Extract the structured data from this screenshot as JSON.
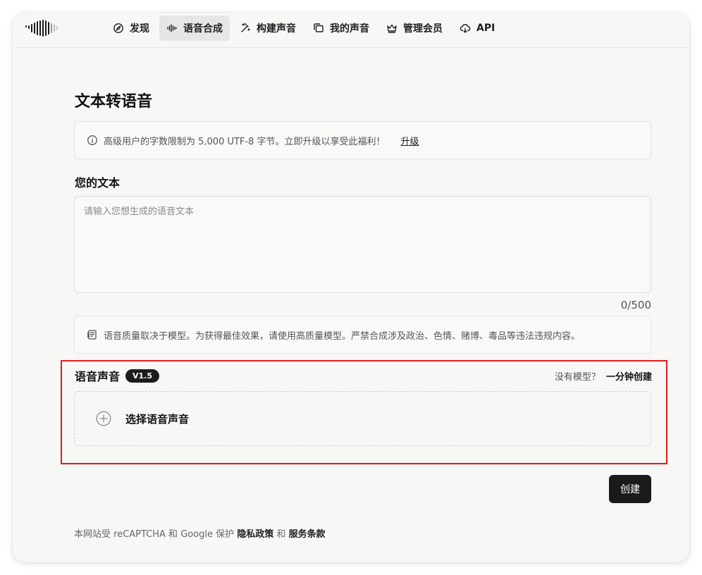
{
  "nav": {
    "items": [
      {
        "label": "发现",
        "icon": "compass-icon",
        "active": false
      },
      {
        "label": "语音合成",
        "icon": "waveform-icon",
        "active": true
      },
      {
        "label": "构建声音",
        "icon": "magic-wand-icon",
        "active": false
      },
      {
        "label": "我的声音",
        "icon": "folders-icon",
        "active": false
      },
      {
        "label": "管理会员",
        "icon": "crown-icon",
        "active": false
      },
      {
        "label": "API",
        "icon": "cloud-api-icon",
        "active": false
      }
    ]
  },
  "page": {
    "title": "文本转语音",
    "notice": {
      "text": "高级用户的字数限制为 5,000 UTF-8 字节。立即升级以享受此福利！",
      "link": "升级",
      "icon": "info-icon"
    },
    "text_section": {
      "label": "您的文本",
      "placeholder": "请输入您想生成的语音文本",
      "value": "",
      "counter": "0/500"
    },
    "quality_notice": {
      "text": "语音质量取决于模型。为获得最佳效果，请使用高质量模型。严禁合成涉及政治、色情、赌博、毒品等违法违规内容。",
      "icon": "document-icon"
    },
    "voice": {
      "title": "语音声音",
      "version": "V1.5",
      "no_model": "没有模型？",
      "create_link": "一分钟创建",
      "select_label": "选择语音声音",
      "select_icon": "plus-circle-icon"
    },
    "create_button": "创建",
    "footer": {
      "prefix": "本网站受 reCAPTCHA 和 Google 保护",
      "privacy": "隐私政策",
      "and": "和",
      "terms": "服务条款"
    }
  },
  "colors": {
    "accent": "#1a1a1a",
    "highlight": "#e01b1b",
    "background": "#f7f7f6"
  }
}
